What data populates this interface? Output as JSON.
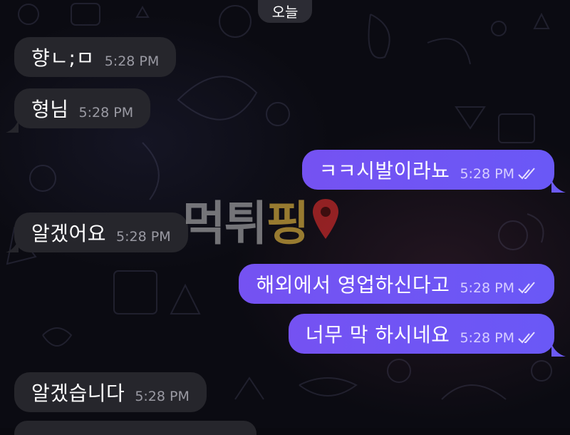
{
  "date_divider": "오늘",
  "messages": [
    {
      "text": "향ㄴ;ㅁ",
      "time": "5:28 PM",
      "direction": "incoming"
    },
    {
      "text": "형님",
      "time": "5:28 PM",
      "direction": "incoming"
    },
    {
      "text": "ㅋㅋ시발이라뇨",
      "time": "5:28 PM",
      "direction": "outgoing",
      "read": true
    },
    {
      "text": "알겠어요",
      "time": "5:28 PM",
      "direction": "incoming"
    },
    {
      "text": "해외에서 영업하신다고",
      "time": "5:28 PM",
      "direction": "outgoing",
      "read": true
    },
    {
      "text": "너무 막 하시네요",
      "time": "5:28 PM",
      "direction": "outgoing",
      "read": true
    },
    {
      "text": "알겠습니다",
      "time": "5:28 PM",
      "direction": "incoming"
    }
  ],
  "watermark": {
    "text_1": "먹튀",
    "text_2": "핑",
    "icon": "map-pin-icon"
  },
  "colors": {
    "incoming_bubble": "#26262c",
    "outgoing_bubble": "#6a58f6",
    "background": "#0b0b12"
  }
}
